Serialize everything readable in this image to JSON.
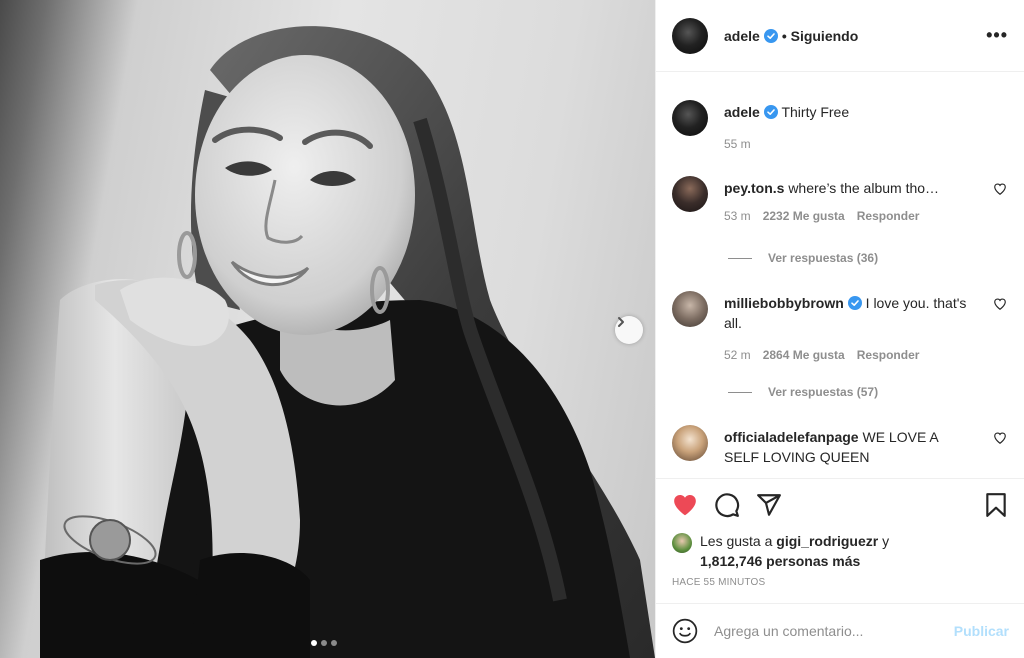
{
  "post": {
    "author": "adele",
    "follow_status": "• Siguiendo",
    "more_icon": "more-options-icon",
    "caption": "Thirty Free",
    "caption_time": "55 m"
  },
  "comments": [
    {
      "user": "pey.ton.s",
      "text": "where’s the album tho…",
      "time": "53 m",
      "likes": "2232 Me gusta",
      "reply": "Responder",
      "replies": "Ver respuestas (36)",
      "verified": false
    },
    {
      "user": "milliebobbybrown",
      "text": "I love you. that's all.",
      "time": "52 m",
      "likes": "2864 Me gusta",
      "reply": "Responder",
      "replies": "Ver respuestas (57)",
      "verified": true
    },
    {
      "user": "officialadelefanpage",
      "text": "WE LOVE A SELF LOVING QUEEN",
      "verified": false
    }
  ],
  "likes": {
    "prefix": "Les gusta a",
    "user": "gigi_rodriguezr",
    "conj": "y",
    "count": "1,812,746 personas más"
  },
  "timestamp": "HACE 55 MINUTOS",
  "comment_box": {
    "placeholder": "Agrega un comentario...",
    "publish": "Publicar"
  },
  "colors": {
    "heart_red": "#ed4956",
    "verified_blue": "#3897f0",
    "publish_disabled": "#b2dffc"
  },
  "carousel": {
    "slides": 3,
    "active_index": 0
  }
}
